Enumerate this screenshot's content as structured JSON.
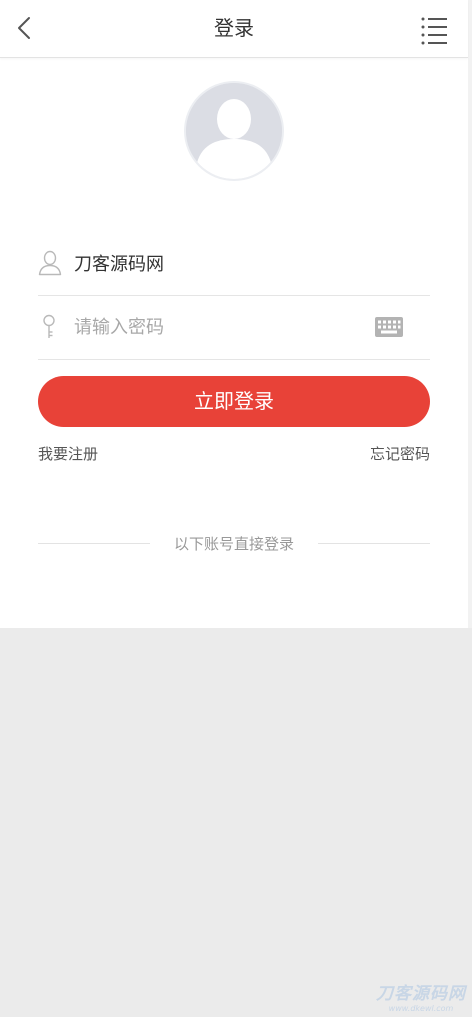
{
  "header": {
    "title": "登录",
    "back_icon": "chevron-left-icon",
    "menu_icon": "list-menu-icon"
  },
  "avatar": {
    "icon": "user-silhouette-icon"
  },
  "form": {
    "username": {
      "icon": "user-outline-icon",
      "value": "刀客源码网"
    },
    "password": {
      "icon": "key-icon",
      "placeholder": "请输入密码",
      "value": "",
      "keyboard_icon": "keyboard-icon"
    },
    "login_button": "立即登录"
  },
  "links": {
    "register": "我要注册",
    "forgot": "忘记密码"
  },
  "third_party": {
    "label": "以下账号直接登录"
  },
  "watermark": {
    "main": "刀客源码网",
    "sub": "www.dkewl.com"
  },
  "colors": {
    "accent": "#e84238",
    "background": "#ebebeb",
    "avatar_bg": "#dbdde4"
  }
}
